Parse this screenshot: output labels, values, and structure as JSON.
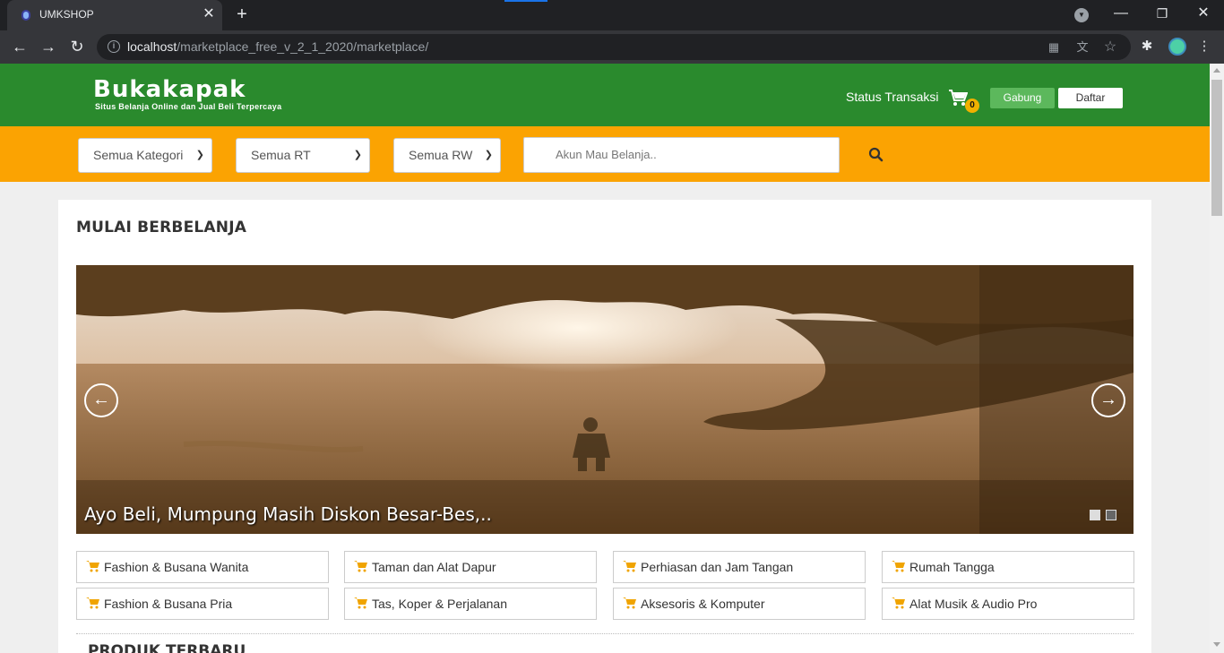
{
  "browser": {
    "tab_title": "UMKSHOP",
    "tab_close": "✕",
    "new_tab": "+",
    "url_host": "localhost",
    "url_path": "/marketplace_free_v_2_1_2020/marketplace/",
    "window_controls": {
      "minimize": "—",
      "restore": "❐",
      "close": "✕"
    }
  },
  "header": {
    "logo": "Bukakapak",
    "tagline": "Situs Belanja Online dan Jual Beli Terpercaya",
    "status_link": "Status Transaksi",
    "cart_count": "0",
    "gabung_label": "Gabung",
    "daftar_label": "Daftar",
    "bg_color": "#2a8a2d"
  },
  "search": {
    "category_select": "Semua Kategori",
    "rt_select": "Semua RT",
    "rw_select": "Semua RW",
    "placeholder": "Akun Mau Belanja..",
    "bg_color": "#fba302"
  },
  "main": {
    "section_title": "MULAI BERBELANJA",
    "carousel_caption": "Ayo Beli, Mumpung Masih Diskon Besar-Bes,..",
    "carousel_prev": "←",
    "carousel_next": "→",
    "categories": [
      {
        "label": "Fashion & Busana Wanita",
        "icon": "cart-icon"
      },
      {
        "label": "Taman dan Alat Dapur",
        "icon": "cart-icon"
      },
      {
        "label": "Perhiasan dan Jam Tangan",
        "icon": "cart-icon"
      },
      {
        "label": "Rumah Tangga",
        "icon": "cart-icon"
      },
      {
        "label": "Fashion & Busana Pria",
        "icon": "cart-icon"
      },
      {
        "label": "Tas, Koper & Perjalanan",
        "icon": "cart-icon"
      },
      {
        "label": "Aksesoris & Komputer",
        "icon": "cart-icon"
      },
      {
        "label": "Alat Musik & Audio Pro",
        "icon": "cart-icon"
      }
    ],
    "section2_title": "PRODUK TERBARU"
  }
}
